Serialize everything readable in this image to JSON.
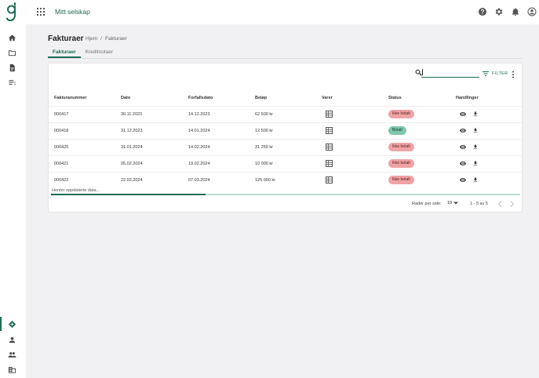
{
  "app": {
    "company_name": "Mitt selskap",
    "logo_glyph": "g"
  },
  "icons": {
    "topbar": [
      "apps-grid-icon",
      "help-icon",
      "settings-gear-icon",
      "notifications-bell-icon",
      "account-circle-icon"
    ],
    "sidebar_top": [
      "home-icon",
      "folder-icon",
      "document-icon",
      "list-icon"
    ],
    "sidebar_bottom": [
      "invoice-tag-icon",
      "person-icon",
      "people-icon",
      "business-icon"
    ]
  },
  "header": {
    "title": "Fakturaer",
    "breadcrumb": [
      "Hjem",
      "Fakturaer"
    ],
    "breadcrumb_separator": "/"
  },
  "tabs": [
    {
      "label": "Fakturaer",
      "active": true
    },
    {
      "label": "Kreditnotaer",
      "active": false
    }
  ],
  "toolbar": {
    "search_value": "",
    "filter_label": "FILTER"
  },
  "table": {
    "columns": [
      "Fakturanummer",
      "Dato",
      "Forfallsdato",
      "Beløp",
      "Varer",
      "Status",
      "Handlinger"
    ],
    "rows": [
      {
        "number": "000417",
        "date": "30.11.2023",
        "due": "14.12.2023",
        "amount": "62 500 kr",
        "status": "Ikke betalt",
        "paid": false
      },
      {
        "number": "000418",
        "date": "31.12.2023",
        "due": "14.01.2024",
        "amount": "12 500 kr",
        "status": "Betalt",
        "paid": true
      },
      {
        "number": "000420",
        "date": "31.01.2024",
        "due": "14.02.2024",
        "amount": "31 250 kr",
        "status": "Ikke betalt",
        "paid": false
      },
      {
        "number": "000421",
        "date": "05.02.2024",
        "due": "19.02.2024",
        "amount": "10 000 kr",
        "status": "Ikke betalt",
        "paid": false
      },
      {
        "number": "000422",
        "date": "22.02.2024",
        "due": "07.03.2024",
        "amount": "125 000 kr",
        "status": "Ikke betalt",
        "paid": false
      }
    ]
  },
  "loading": {
    "text": "Henter oppdaterte data...",
    "progress": 0.33
  },
  "pagination": {
    "rows_per_page_label": "Rader per side:",
    "rows_per_page": "10",
    "range": "1 - 5 av 5"
  },
  "colors": {
    "accent": "#1c6b55",
    "unpaid_badge": "#f0a3a6",
    "paid_badge": "#7fc7ad"
  }
}
